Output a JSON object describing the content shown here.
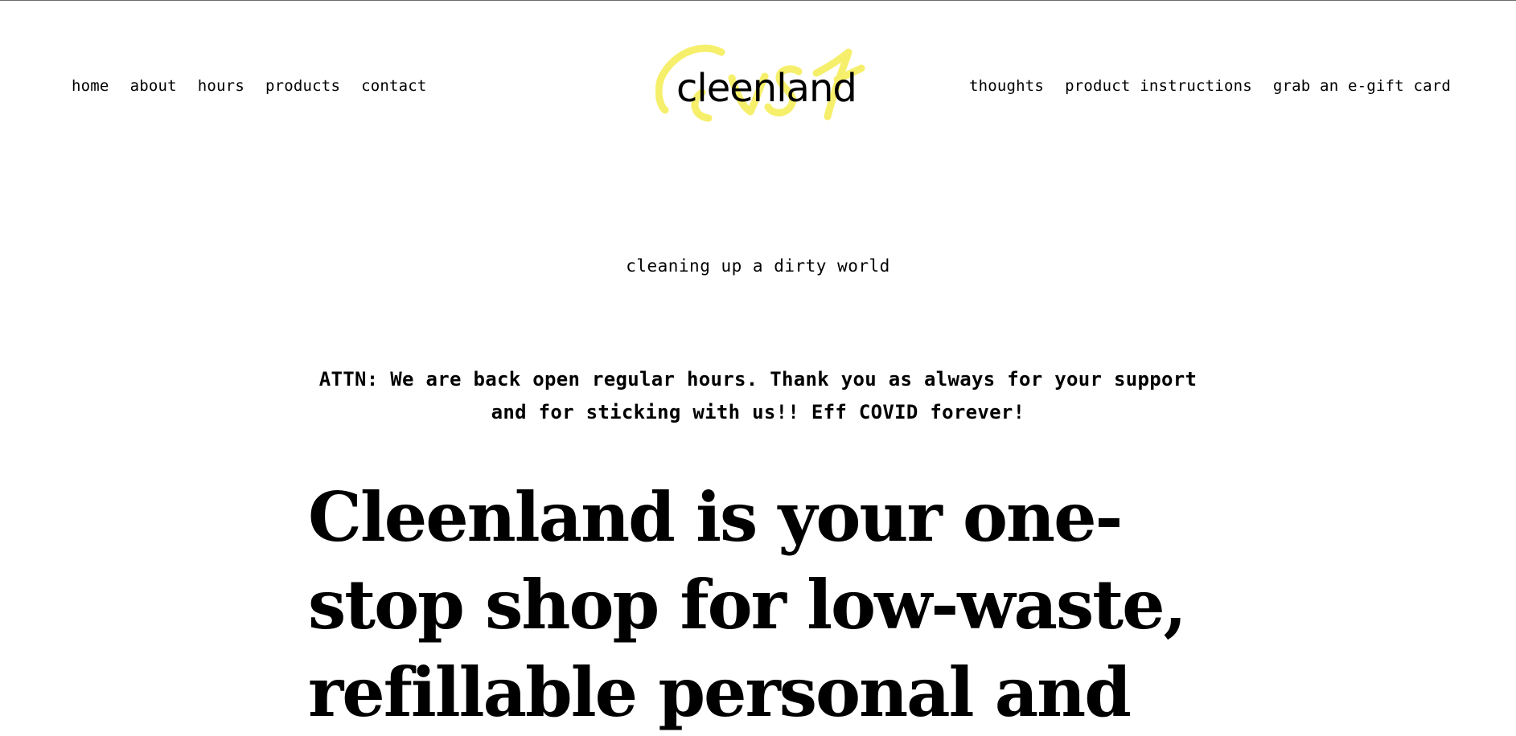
{
  "header": {
    "nav_left": [
      "home",
      "about",
      "hours",
      "products",
      "contact"
    ],
    "nav_right": [
      "thoughts",
      "product instructions",
      "grab an e-gift card"
    ],
    "logo_text": "cleenland",
    "logo_scribble_color": "#f6ef6b"
  },
  "tagline": "cleaning up a dirty world",
  "notice": "ATTN: We are back open regular hours. Thank you as always for your support and for sticking with us!! Eff COVID forever!",
  "hero": "Cleenland is your one-stop shop for low-waste, refillable personal and"
}
